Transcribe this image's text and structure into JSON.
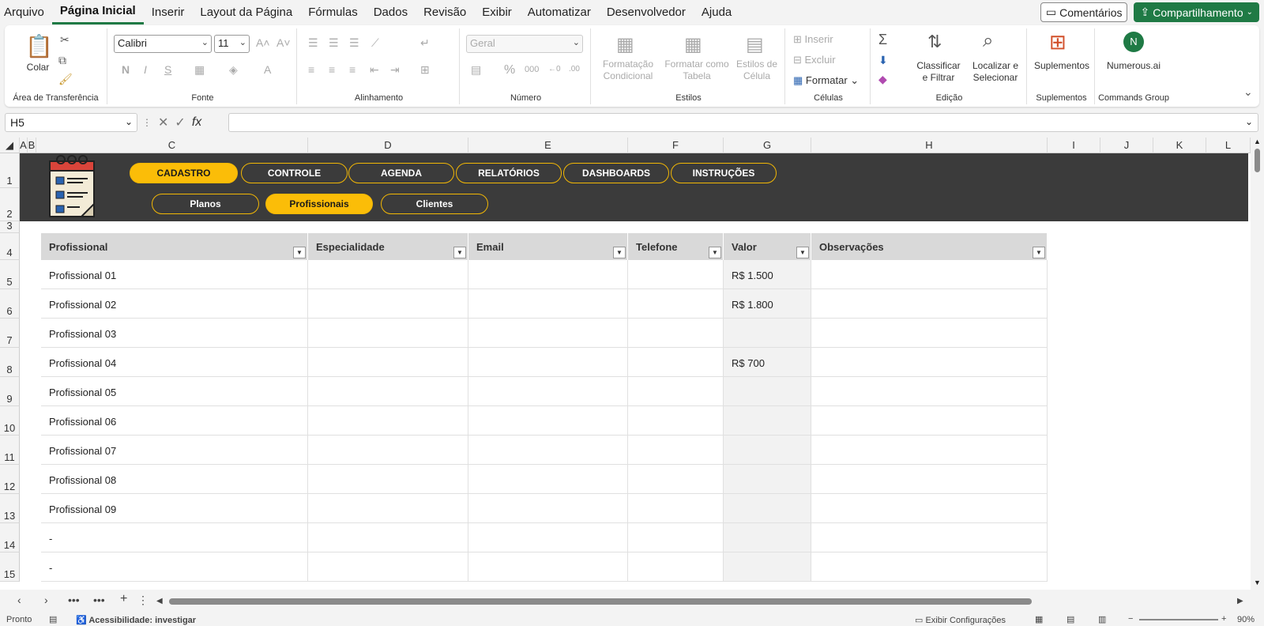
{
  "menu": {
    "tabs": [
      "Arquivo",
      "Página Inicial",
      "Inserir",
      "Layout da Página",
      "Fórmulas",
      "Dados",
      "Revisão",
      "Exibir",
      "Automatizar",
      "Desenvolvedor",
      "Ajuda"
    ],
    "active": "Página Inicial",
    "comments_label": "Comentários",
    "share_label": "Compartilhamento"
  },
  "ribbon": {
    "clipboard": {
      "paste_label": "Colar",
      "group_label": "Área de Transferência"
    },
    "font": {
      "font_name": "Calibri",
      "font_size": "11",
      "group_label": "Fonte"
    },
    "alignment": {
      "group_label": "Alinhamento"
    },
    "number": {
      "format": "Geral",
      "group_label": "Número"
    },
    "styles": {
      "conditional_label": "Formatação Condicional",
      "table_label": "Formatar como Tabela",
      "cell_styles_label": "Estilos de Célula",
      "group_label": "Estilos"
    },
    "cells": {
      "insert_label": "Inserir",
      "delete_label": "Excluir",
      "format_label": "Formatar",
      "group_label": "Células"
    },
    "editing": {
      "sort_label": "Classificar e Filtrar",
      "find_label": "Localizar e Selecionar",
      "group_label": "Edição"
    },
    "addins": {
      "label": "Suplementos",
      "group_label": "Suplementos"
    },
    "commands": {
      "label": "Numerous.ai",
      "group_label": "Commands Group"
    }
  },
  "formula_bar": {
    "name_box": "H5",
    "formula": ""
  },
  "columns": [
    "A",
    "B",
    "C",
    "D",
    "E",
    "F",
    "G",
    "H",
    "I",
    "J",
    "K",
    "L"
  ],
  "rows": [
    "1",
    "2",
    "3",
    "4",
    "5",
    "6",
    "7",
    "8",
    "9",
    "10",
    "11",
    "12",
    "13",
    "14",
    "15"
  ],
  "nav": {
    "main_tabs": [
      "CADASTRO",
      "CONTROLE",
      "AGENDA",
      "RELATÓRIOS",
      "DASHBOARDS",
      "INSTRUÇÕES"
    ],
    "main_active": "CADASTRO",
    "sub_tabs": [
      "Planos",
      "Profissionais",
      "Clientes"
    ],
    "sub_active": "Profissionais"
  },
  "table": {
    "headers": [
      "Profissional",
      "Especialidade",
      "Email",
      "Telefone",
      "Valor",
      "Observações"
    ],
    "rows": [
      [
        "Profissional 01",
        "",
        "",
        "",
        "R$ 1.500",
        ""
      ],
      [
        "Profissional 02",
        "",
        "",
        "",
        "R$ 1.800",
        ""
      ],
      [
        "Profissional 03",
        "",
        "",
        "",
        "",
        ""
      ],
      [
        "Profissional 04",
        "",
        "",
        "",
        "R$ 700",
        ""
      ],
      [
        "Profissional 05",
        "",
        "",
        "",
        "",
        ""
      ],
      [
        "Profissional 06",
        "",
        "",
        "",
        "",
        ""
      ],
      [
        "Profissional 07",
        "",
        "",
        "",
        "",
        ""
      ],
      [
        "Profissional 08",
        "",
        "",
        "",
        "",
        ""
      ],
      [
        "Profissional 09",
        "",
        "",
        "",
        "",
        ""
      ],
      [
        "-",
        "",
        "",
        "",
        "",
        ""
      ],
      [
        "-",
        "",
        "",
        "",
        "",
        ""
      ]
    ]
  },
  "status": {
    "ready": "Pronto",
    "accessibility": "Acessibilidade: investigar",
    "display_settings": "Exibir Configurações",
    "zoom": "90%"
  },
  "colors": {
    "accent_green": "#1f7a45",
    "banner": "#3b3b3b",
    "pill_active": "#fbbd08"
  }
}
